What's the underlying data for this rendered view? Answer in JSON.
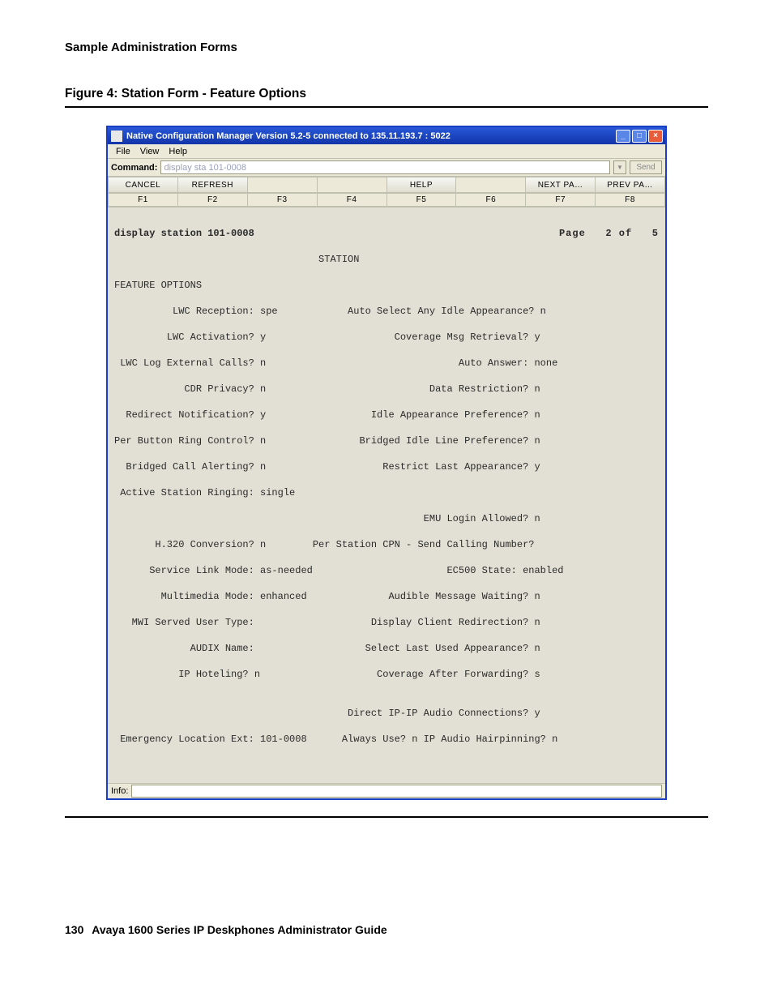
{
  "page": {
    "header": "Sample Administration Forms",
    "figure_caption": "Figure 4: Station Form - Feature Options",
    "footer_number": "130",
    "footer_guide": "Avaya 1600 Series IP Deskphones Administrator Guide"
  },
  "window": {
    "title": "Native Configuration Manager Version 5.2-5 connected to 135.11.193.7 : 5022",
    "menu": {
      "file": "File",
      "view": "View",
      "help": "Help"
    },
    "command_label": "Command:",
    "command_value": "display sta 101-0008",
    "send_label": "Send",
    "toolbar": {
      "cancel": "CANCEL",
      "refresh": "REFRESH",
      "blank3": "",
      "blank4": "",
      "help": "HELP",
      "blank6": "",
      "next": "NEXT  PA…",
      "prev": "PREV  PA…"
    },
    "fkeys": {
      "f1": "F1",
      "f2": "F2",
      "f3": "F3",
      "f4": "F4",
      "f5": "F5",
      "f6": "F6",
      "f7": "F7",
      "f8": "F8"
    },
    "info_label": "Info:"
  },
  "terminal": {
    "display_line_left": "display station 101-0008",
    "display_line_right": "Page   2 of   5",
    "station_label": "                                   STATION",
    "section": "FEATURE OPTIONS",
    "l1": "          LWC Reception: spe            Auto Select Any Idle Appearance? n",
    "l2": "         LWC Activation? y                      Coverage Msg Retrieval? y",
    "l3": " LWC Log External Calls? n                                 Auto Answer: none",
    "l4": "            CDR Privacy? n                            Data Restriction? n",
    "l5": "  Redirect Notification? y                  Idle Appearance Preference? n",
    "l6": "Per Button Ring Control? n                Bridged Idle Line Preference? n",
    "l7": "  Bridged Call Alerting? n                    Restrict Last Appearance? y",
    "l8": " Active Station Ringing: single",
    "l9": "                                                     EMU Login Allowed? n",
    "l10": "       H.320 Conversion? n        Per Station CPN - Send Calling Number?",
    "l11": "      Service Link Mode: as-needed                       EC500 State: enabled",
    "l12": "        Multimedia Mode: enhanced              Audible Message Waiting? n",
    "l13": "   MWI Served User Type:                    Display Client Redirection? n",
    "l14": "             AUDIX Name:                   Select Last Used Appearance? n",
    "l15": "           IP Hoteling? n                    Coverage After Forwarding? s",
    "l16": "",
    "l17": "                                        Direct IP-IP Audio Connections? y",
    "l18": " Emergency Location Ext: 101-0008      Always Use? n IP Audio Hairpinning? n"
  }
}
